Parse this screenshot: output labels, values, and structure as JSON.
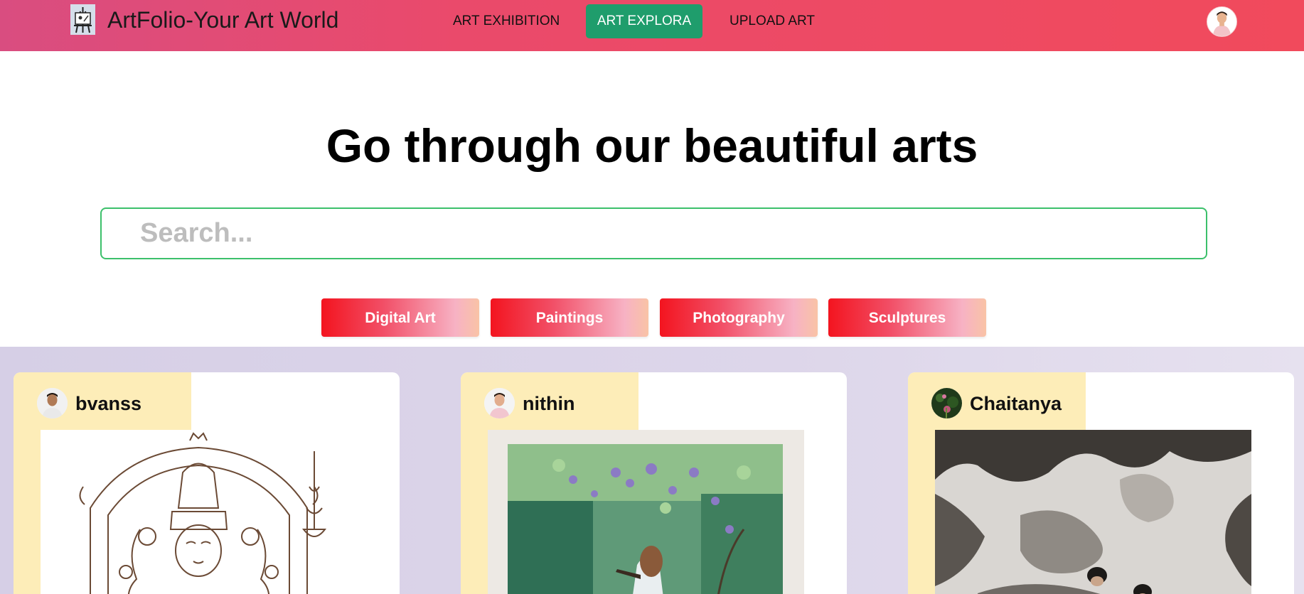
{
  "header": {
    "brand_title": "ArtFolio-Your Art World",
    "nav": [
      {
        "label": "ART EXHIBITION",
        "active": false
      },
      {
        "label": "ART EXPLORA",
        "active": true
      },
      {
        "label": "UPLOAD ART",
        "active": false
      }
    ],
    "colors": {
      "gradient_start": "#d94d80",
      "gradient_end": "#f14a5c",
      "active_tab": "#1f9d6c"
    }
  },
  "hero": {
    "title": "Go through our beautiful arts"
  },
  "search": {
    "value": "",
    "placeholder": "Search..."
  },
  "categories": [
    {
      "label": "Digital Art"
    },
    {
      "label": "Paintings"
    },
    {
      "label": "Photography"
    },
    {
      "label": "Sculptures"
    }
  ],
  "gallery": {
    "cards": [
      {
        "user": "bvanss",
        "artwork": "pencil-sketch-deity"
      },
      {
        "user": "nithin",
        "artwork": "watercolor-painting-forest"
      },
      {
        "user": "Chaitanya",
        "artwork": "wall-photograph"
      }
    ],
    "colors": {
      "card_band": "#fdedb8",
      "background": "#d6cfe6"
    }
  },
  "icons": {
    "brand": "easel-logo-icon",
    "profile": "user-avatar-icon"
  }
}
